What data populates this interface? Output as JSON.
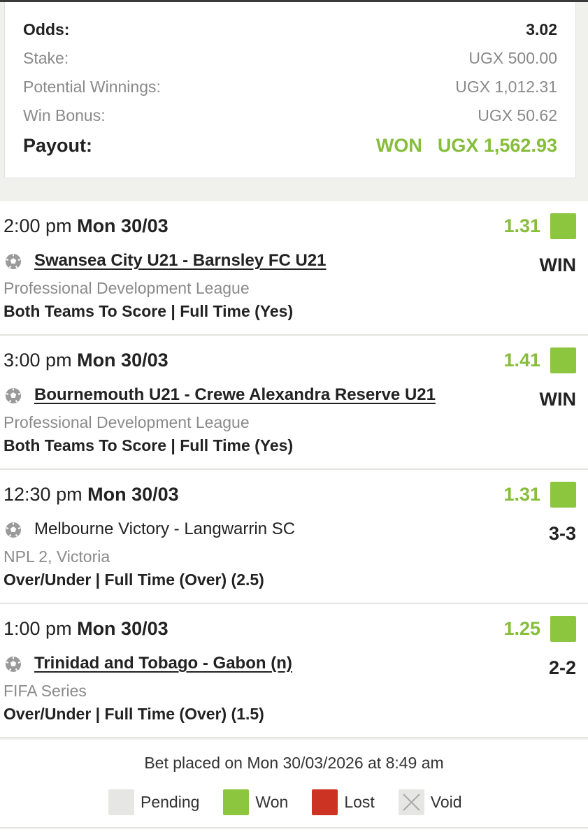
{
  "summary": {
    "odds_label": "Odds:",
    "odds_value": "3.02",
    "stake_label": "Stake:",
    "stake_value": "UGX 500.00",
    "potential_label": "Potential Winnings:",
    "potential_value": "UGX 1,012.31",
    "bonus_label": "Win Bonus:",
    "bonus_value": "UGX 50.62",
    "payout_label": "Payout:",
    "payout_status": "WON",
    "payout_value": "UGX 1,562.93"
  },
  "bets": [
    {
      "time": "2:00 pm",
      "date": "Mon 30/03",
      "odds": "1.31",
      "match": "Swansea City U21 - Barnsley FC U21",
      "linked": true,
      "result": "WIN",
      "league": "Professional Development League",
      "market": "Both Teams To Score | Full Time (Yes)"
    },
    {
      "time": "3:00 pm",
      "date": "Mon 30/03",
      "odds": "1.41",
      "match": "Bournemouth U21 - Crewe Alexandra Reserve U21",
      "linked": true,
      "result": "WIN",
      "league": "Professional Development League",
      "market": "Both Teams To Score | Full Time (Yes)"
    },
    {
      "time": "12:30 pm",
      "date": "Mon 30/03",
      "odds": "1.31",
      "match": "Melbourne Victory - Langwarrin SC",
      "linked": false,
      "result": "3-3",
      "league": "NPL 2, Victoria",
      "market": "Over/Under | Full Time (Over) (2.5)"
    },
    {
      "time": "1:00 pm",
      "date": "Mon 30/03",
      "odds": "1.25",
      "match": "Trinidad and Tobago - Gabon (n)",
      "linked": true,
      "result": "2-2",
      "league": "FIFA Series",
      "market": "Over/Under | Full Time (Over) (1.5)"
    }
  ],
  "footer": {
    "placed": "Bet placed on Mon 30/03/2026 at 8:49 am",
    "legend": [
      {
        "label": "Pending",
        "color": "#e6e6e4"
      },
      {
        "label": "Won",
        "color": "#8cc63f"
      },
      {
        "label": "Lost",
        "color": "#cc3322"
      },
      {
        "label": "Void",
        "color": "#e6e6e4"
      }
    ]
  },
  "colors": {
    "won": "#8cc63f",
    "accent_text": "#86bd3a"
  },
  "icons": {
    "sport": "soccer-ball-icon",
    "void": "cross-icon"
  }
}
